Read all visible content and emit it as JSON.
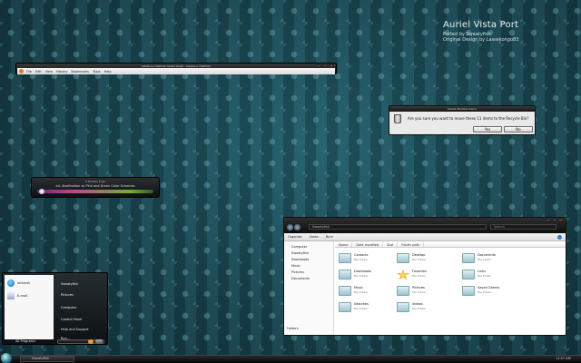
{
  "branding": {
    "title": "Auriel Vista Port",
    "line1": "Ported by Sweatyfish",
    "line2": "Original Design by Lassekongo83"
  },
  "firefox": {
    "title": "MOZILLA FIREFOX START PAGE - MOZILLA FIREFOX",
    "menu": [
      "File",
      "Edit",
      "View",
      "History",
      "Bookmarks",
      "Tools",
      "Help"
    ]
  },
  "dialog": {
    "title": "Delete Multiple Items",
    "message": "Are you sure you want to move these 11 items to the Recycle Bin?",
    "yes": "Yes",
    "no": "No"
  },
  "media": {
    "line1": "4 Strokes Eulpi",
    "line2": "e4, Starfication w/ Pink and Green Color Schemes",
    "progress": 0.04
  },
  "start_menu": {
    "pinned": [
      {
        "label": "Internet",
        "icon": "globe-icon"
      },
      {
        "label": "E-mail",
        "icon": "mail-icon"
      }
    ],
    "all_programs": "All Programs",
    "right": [
      "Sweatyfish",
      "Pictures",
      "Computer",
      "Control Panel",
      "Help and Support",
      "Run..."
    ]
  },
  "explorer": {
    "address": "Sweatyfish",
    "search": "Search",
    "commands": [
      "Organize",
      "Views",
      "Burn"
    ],
    "nav": [
      "Computer",
      "Sweatyfish",
      "Downloads",
      "Music",
      "Pictures",
      "Documents"
    ],
    "folders_label": "Folders",
    "columns": [
      "Name",
      "Date modified",
      "Size",
      "Folder path"
    ],
    "items": [
      {
        "name": "Contacts",
        "type": "File Folder"
      },
      {
        "name": "Desktop",
        "type": "File Folder"
      },
      {
        "name": "Documents",
        "type": "File Folder"
      },
      {
        "name": "Downloads",
        "type": "File Folder"
      },
      {
        "name": "Favorites",
        "type": "File Folder"
      },
      {
        "name": "Links",
        "type": "File Folder"
      },
      {
        "name": "Music",
        "type": "File Folder"
      },
      {
        "name": "Pictures",
        "type": "File Folder"
      },
      {
        "name": "Saved Games",
        "type": "File Folder"
      },
      {
        "name": "Searches",
        "type": "File Folder"
      },
      {
        "name": "Videos",
        "type": "File Folder"
      }
    ]
  },
  "taskbar": {
    "task": "Sweatyfish",
    "clock": "11:57 AM"
  }
}
